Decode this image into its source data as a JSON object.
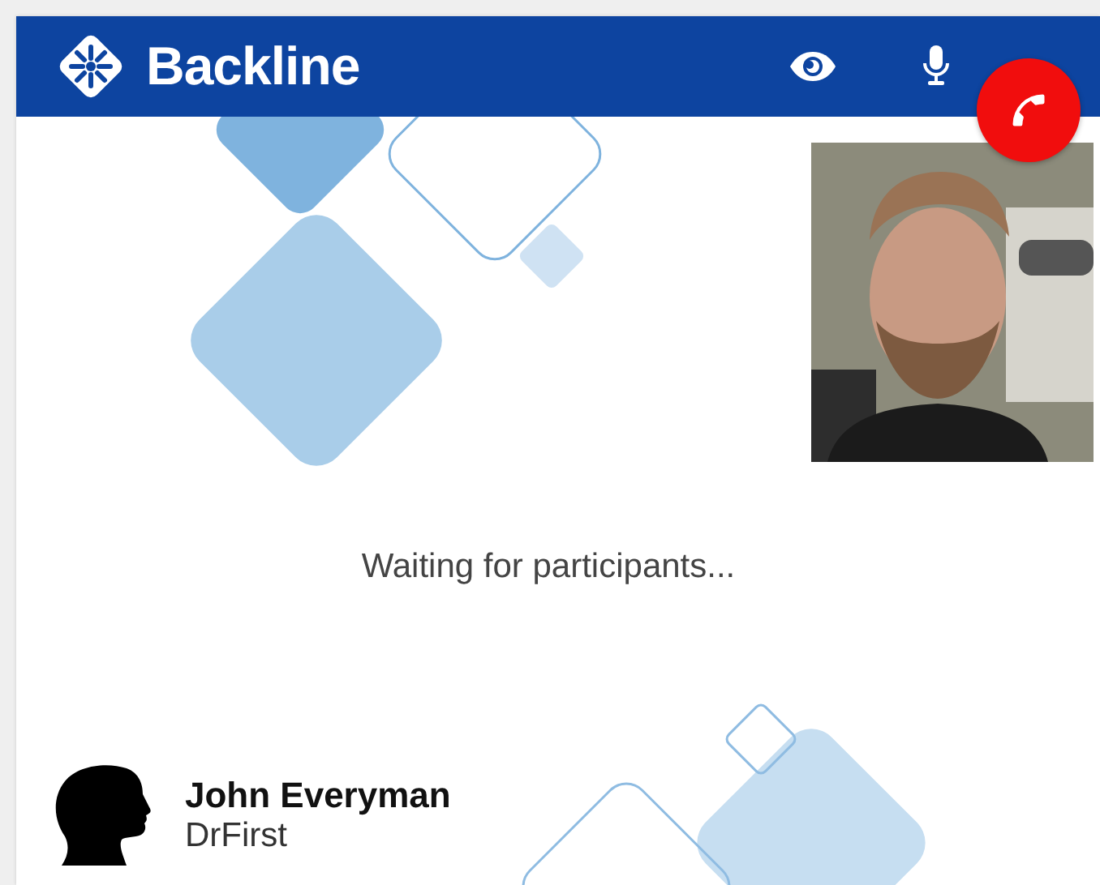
{
  "header": {
    "brand": "Backline",
    "controls": [
      {
        "kind": "view"
      },
      {
        "kind": "microphone"
      },
      {
        "kind": "end_call"
      }
    ]
  },
  "status": "Waiting for participants...",
  "participant": {
    "name": "John Everyman",
    "organization": "DrFirst"
  }
}
